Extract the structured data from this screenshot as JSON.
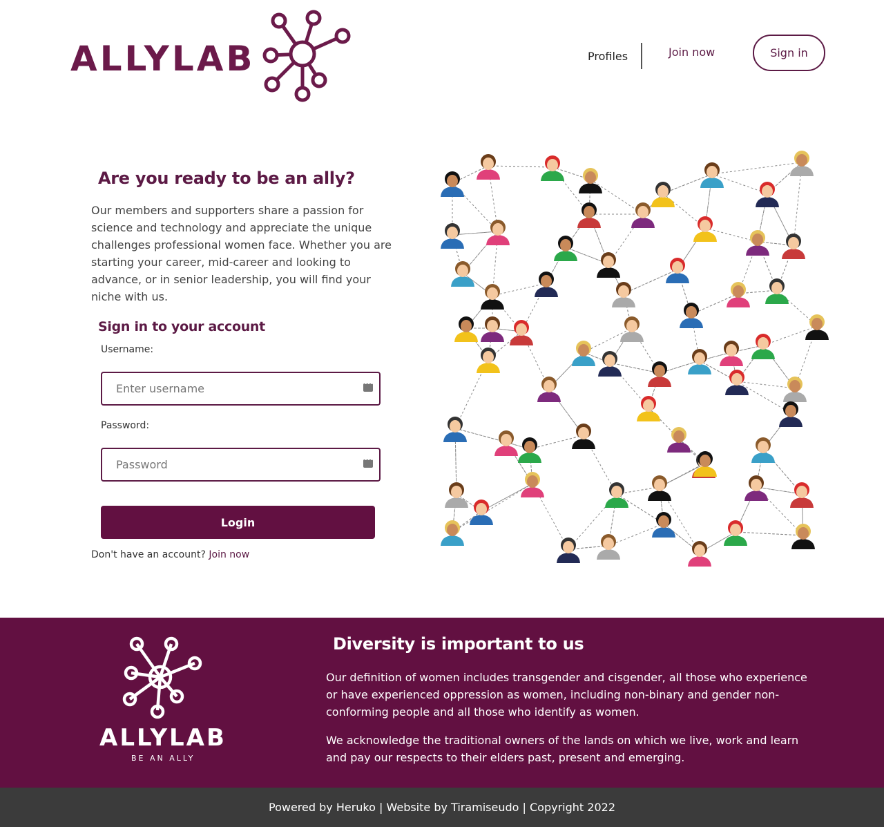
{
  "header": {
    "logo_text": "ALLYLAB",
    "nav": {
      "profiles": "Profiles",
      "join": "Join now",
      "signin": "Sign in"
    }
  },
  "hero": {
    "title": "Are you ready to be an ally?",
    "text": "Our members and supporters share a passion for science and technology and appreciate the unique challenges professional women face. Whether you are starting your career, mid-career and looking to advance, or in senior leadership, you will find your niche with us."
  },
  "login": {
    "title": "Sign in to your account",
    "username_label": "Username:",
    "username_placeholder": "Enter username",
    "password_label": "Password:",
    "password_placeholder": "Password",
    "button": "Login",
    "no_account": "Don't have an account?",
    "join_link": "Join now"
  },
  "footer": {
    "logo_text": "ALLYLAB",
    "logo_tagline": "BE AN ALLY",
    "title": "Diversity is important to us",
    "p1": "Our definition of women includes transgender and cisgender, all those who experience or have experienced oppression as women, including non-binary and gender non-conforming people and all those who identify as women.",
    "p2": "We acknowledge the traditional owners of the lands on which we live, work and learn and pay our respects to their elders past, present and emerging.",
    "copyright": "Powered by Heruko | Website by Tiramiseudo | Copyright 2022"
  },
  "colors": {
    "brand": "#621041",
    "dark_footer": "#3b3b3b"
  },
  "icons": {
    "logo_mark": "molecule-network-icon",
    "field_icon": "password-manager-icon"
  }
}
